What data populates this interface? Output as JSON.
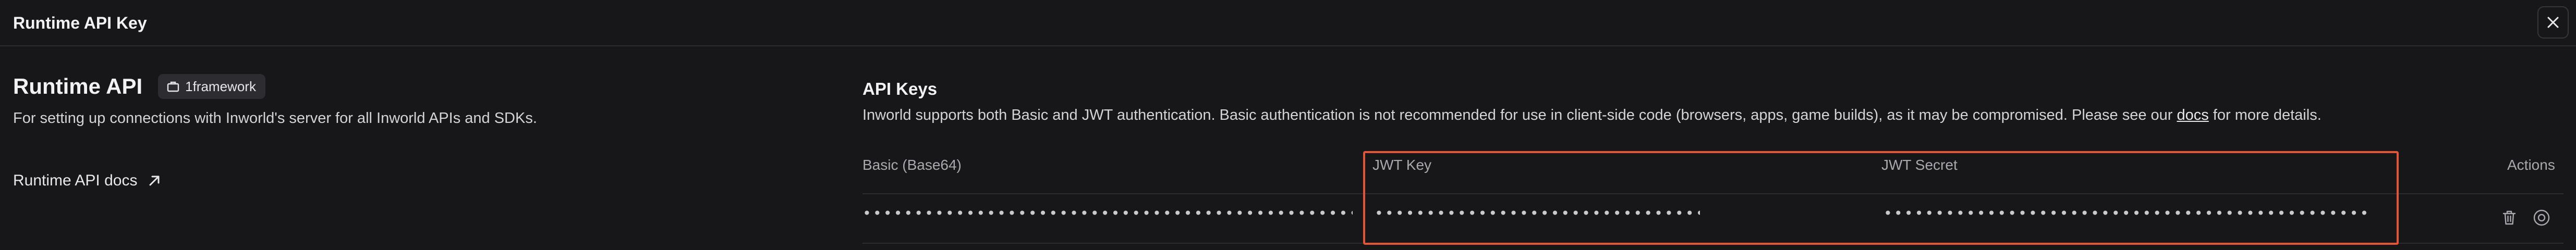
{
  "dialog": {
    "title": "Runtime API Key"
  },
  "runtime_api": {
    "title": "Runtime API",
    "workspace_badge": "1framework",
    "description": "For setting up connections with Inworld's server for all Inworld APIs and SDKs.",
    "docs_link": "Runtime API docs"
  },
  "api_keys": {
    "title": "API Keys",
    "description_before": "Inworld supports both Basic and JWT authentication. Basic authentication is not recommended for use in client-side code (browsers, apps, game builds), as it may be compromised. Please see our ",
    "description_link": "docs",
    "description_after": " for more details.",
    "columns": {
      "basic": "Basic (Base64)",
      "jwt_key": "JWT Key",
      "jwt_secret": "JWT Secret",
      "actions": "Actions"
    },
    "rows": [
      {
        "basic": "••••••••••••••••••••••••••••••••••••••••••••••••••••••••••••••••••••••••••••••",
        "jwt_key": "••••••••••••••••••••••••••••••••••••••••••••",
        "jwt_secret": "••••••••••••••••••••••••••••••••••••••••••••••••••••••••••••••••••••"
      }
    ]
  },
  "icons": {
    "close": "close-icon",
    "badge": "briefcase-icon",
    "external": "arrow-up-right-icon",
    "delete": "trash-icon",
    "toggle": "circle-dot-icon"
  },
  "colors": {
    "background": "#17171a",
    "highlight": "#e2553a",
    "badge_bg": "#2c2c31"
  }
}
